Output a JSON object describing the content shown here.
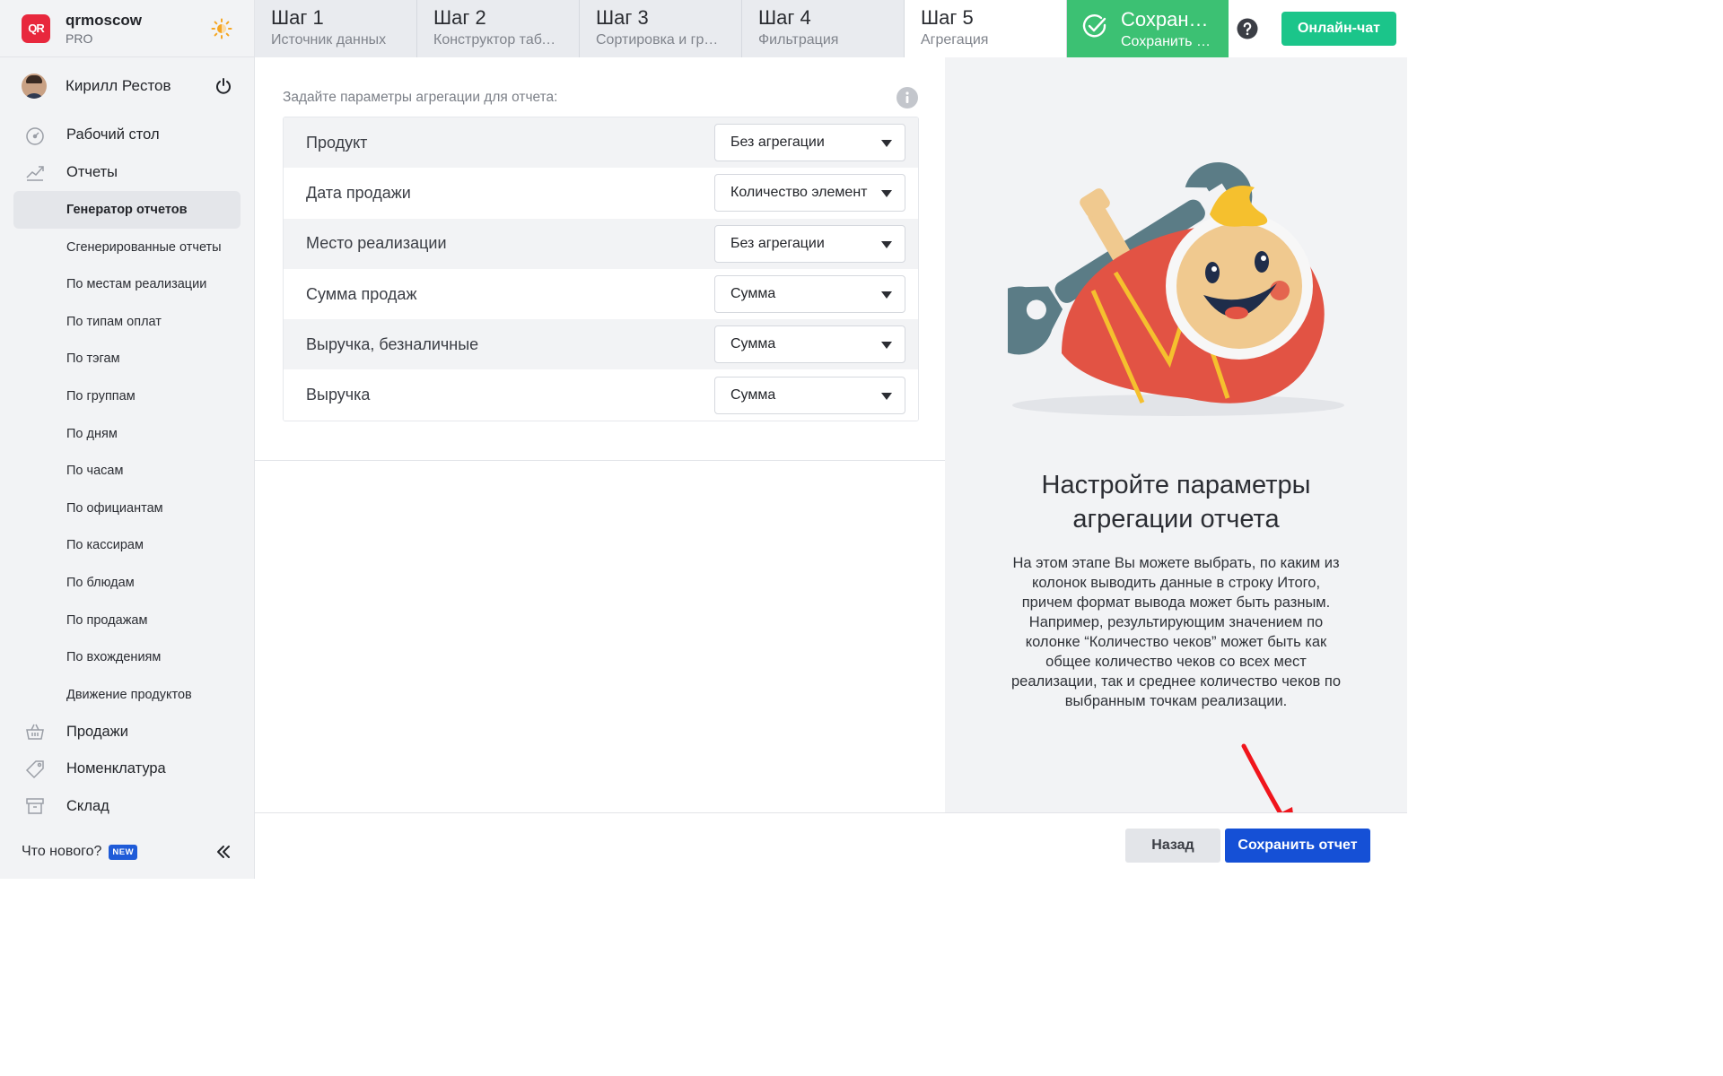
{
  "brand": {
    "name": "qrmoscow",
    "plan": "PRO",
    "logo_text": "QR"
  },
  "user": {
    "name": "Кирилл Рестов"
  },
  "nav": {
    "desktop": "Рабочий стол",
    "reports": "Отчеты",
    "report_items": [
      "Генератор отчетов",
      "Сгенерированные отчеты",
      "По местам реализации",
      "По типам оплат",
      "По тэгам",
      "По группам",
      "По дням",
      "По часам",
      "По официантам",
      "По кассирам",
      "По блюдам",
      "По продажам",
      "По вхождениям",
      "Движение продуктов"
    ],
    "sales": "Продажи",
    "nomenclature": "Номенклатура",
    "warehouse": "Склад",
    "whats_new": "Что нового?",
    "new_badge": "NEW"
  },
  "steps": [
    {
      "title": "Шаг 1",
      "subtitle": "Источник данных"
    },
    {
      "title": "Шаг 2",
      "subtitle": "Конструктор табл…"
    },
    {
      "title": "Шаг 3",
      "subtitle": "Сортировка и гру…"
    },
    {
      "title": "Шаг 4",
      "subtitle": "Фильтрация"
    },
    {
      "title": "Шаг 5",
      "subtitle": "Агрегация"
    }
  ],
  "save_step": {
    "title": "Сохрани…",
    "subtitle": "Сохранить о…"
  },
  "online_chat": "Онлайн-чат",
  "aggregation": {
    "caption": "Задайте параметры агрегации для отчета:",
    "rows": [
      {
        "label": "Продукт",
        "value": "Без агрегации"
      },
      {
        "label": "Дата продажи",
        "value": "Количество элемент"
      },
      {
        "label": "Место реализации",
        "value": "Без агрегации"
      },
      {
        "label": "Сумма продаж",
        "value": "Сумма"
      },
      {
        "label": "Выручка, безналичные",
        "value": "Сумма"
      },
      {
        "label": "Выручка",
        "value": "Сумма"
      }
    ]
  },
  "info": {
    "title": "Настройте параметры агрегации отчета",
    "description": "На этом этапе Вы можете выбрать, по каким из колонок выводить данные в строку Итого, причем формат вывода может быть разным. Например, результирующим значением по колонке “Количество чеков” может быть как общее количество чеков со всех мест реализации, так и среднее количество чеков по выбранным точкам реализации."
  },
  "footer": {
    "back": "Назад",
    "save": "Сохранить отчет"
  },
  "colors": {
    "accent": "#1550d6",
    "success": "#3cc173",
    "chat": "#1bc58a",
    "logo": "#e8283d"
  }
}
